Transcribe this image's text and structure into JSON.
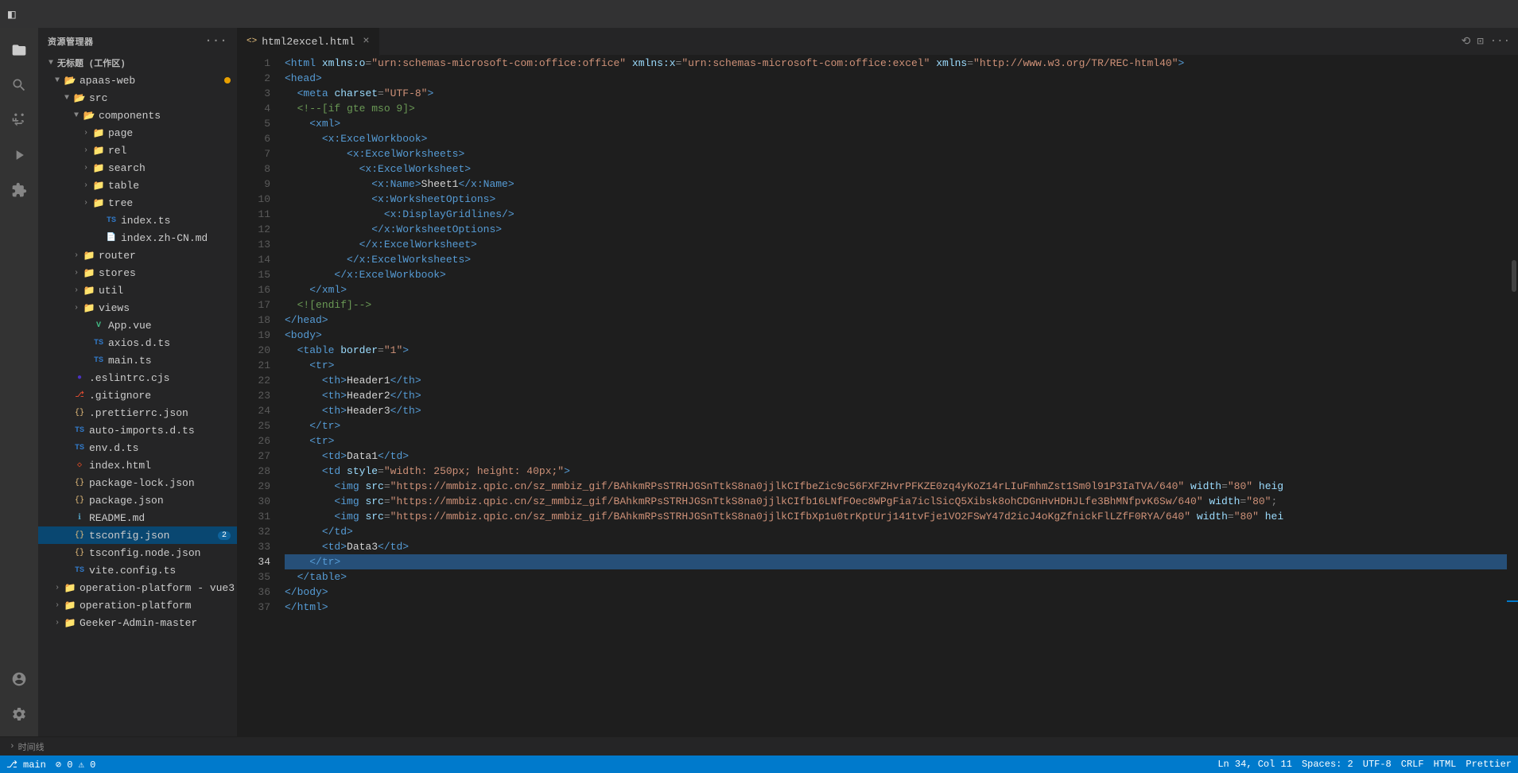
{
  "titleBar": {
    "icon": "◧",
    "title": "资源管理器",
    "dotsLabel": "···"
  },
  "tabs": [
    {
      "id": "tab-html2excel",
      "icon": "<>",
      "label": "html2excel.html",
      "active": true,
      "closable": true
    }
  ],
  "tabBarActions": [
    "⟲",
    "⊡",
    "···"
  ],
  "activityBar": {
    "icons": [
      {
        "id": "files-icon",
        "symbol": "⊞",
        "active": true
      },
      {
        "id": "search-icon",
        "symbol": "🔍",
        "active": false
      },
      {
        "id": "source-control-icon",
        "symbol": "⎇",
        "active": false
      },
      {
        "id": "run-icon",
        "symbol": "▶",
        "active": false
      },
      {
        "id": "extensions-icon",
        "symbol": "⊟",
        "active": false
      }
    ],
    "bottomIcons": [
      {
        "id": "account-icon",
        "symbol": "👤"
      },
      {
        "id": "settings-icon",
        "symbol": "⚙"
      }
    ]
  },
  "sidebar": {
    "title": "资源管理器",
    "workspace": "无标题 (工作区)",
    "tree": [
      {
        "id": "apaas-web",
        "label": "apaas-web",
        "type": "folder-open",
        "indent": 1,
        "expanded": true,
        "dot": true
      },
      {
        "id": "src",
        "label": "src",
        "type": "folder-open",
        "indent": 2,
        "expanded": true
      },
      {
        "id": "components",
        "label": "components",
        "type": "folder-open",
        "indent": 3,
        "expanded": true
      },
      {
        "id": "page",
        "label": "page",
        "type": "folder",
        "indent": 4,
        "expanded": false
      },
      {
        "id": "rel",
        "label": "rel",
        "type": "folder",
        "indent": 4,
        "expanded": false
      },
      {
        "id": "search",
        "label": "search",
        "type": "folder",
        "indent": 4,
        "expanded": false
      },
      {
        "id": "table",
        "label": "table",
        "type": "folder",
        "indent": 4,
        "expanded": false
      },
      {
        "id": "tree",
        "label": "tree",
        "type": "folder",
        "indent": 4,
        "expanded": false
      },
      {
        "id": "index-ts",
        "label": "index.ts",
        "type": "ts",
        "indent": 4
      },
      {
        "id": "index-zh-cn-md",
        "label": "index.zh-CN.md",
        "type": "md",
        "indent": 4
      },
      {
        "id": "router",
        "label": "router",
        "type": "folder",
        "indent": 3,
        "expanded": false
      },
      {
        "id": "stores",
        "label": "stores",
        "type": "folder",
        "indent": 3,
        "expanded": false
      },
      {
        "id": "util",
        "label": "util",
        "type": "folder",
        "indent": 3,
        "expanded": false
      },
      {
        "id": "views",
        "label": "views",
        "type": "folder",
        "indent": 3,
        "expanded": false
      },
      {
        "id": "app-vue",
        "label": "App.vue",
        "type": "vue",
        "indent": 3
      },
      {
        "id": "axios-d-ts",
        "label": "axios.d.ts",
        "type": "ts",
        "indent": 3
      },
      {
        "id": "main-ts",
        "label": "main.ts",
        "type": "ts",
        "indent": 3
      },
      {
        "id": "eslintrc-cjs",
        "label": ".eslintrc.cjs",
        "type": "eslint",
        "indent": 2
      },
      {
        "id": "gitignore",
        "label": ".gitignore",
        "type": "git",
        "indent": 2
      },
      {
        "id": "prettierrc-json",
        "label": ".prettierrc.json",
        "type": "json",
        "indent": 2
      },
      {
        "id": "auto-imports-d-ts",
        "label": "auto-imports.d.ts",
        "type": "ts",
        "indent": 2
      },
      {
        "id": "env-d-ts",
        "label": "env.d.ts",
        "type": "ts",
        "indent": 2
      },
      {
        "id": "index-html",
        "label": "index.html",
        "type": "html",
        "indent": 2
      },
      {
        "id": "package-lock-json",
        "label": "package-lock.json",
        "type": "json",
        "indent": 2
      },
      {
        "id": "package-json",
        "label": "package.json",
        "type": "json",
        "indent": 2
      },
      {
        "id": "readme-md",
        "label": "README.md",
        "type": "md",
        "indent": 2
      },
      {
        "id": "tsconfig-json",
        "label": "tsconfig.json",
        "type": "json",
        "indent": 2,
        "badge": "2",
        "selected": true
      },
      {
        "id": "tsconfig-node-json",
        "label": "tsconfig.node.json",
        "type": "json",
        "indent": 2
      },
      {
        "id": "vite-config-ts",
        "label": "vite.config.ts",
        "type": "ts",
        "indent": 2
      },
      {
        "id": "operation-platform-vue3",
        "label": "operation-platform - vue3",
        "type": "folder",
        "indent": 1,
        "expanded": false
      },
      {
        "id": "operation-platform",
        "label": "operation-platform",
        "type": "folder",
        "indent": 1,
        "expanded": false
      },
      {
        "id": "geeker-admin-master",
        "label": "Geeker-Admin-master",
        "type": "folder",
        "indent": 1,
        "expanded": false
      }
    ]
  },
  "editor": {
    "filename": "html2excel.html",
    "lines": [
      {
        "num": 1,
        "content": "<span class='tag'>&lt;html</span> <span class='attr-name'>xmlns:o</span><span class='punctuation'>=</span><span class='attr-val'>\"urn:schemas-microsoft-com:office:office\"</span> <span class='attr-name'>xmlns:x</span><span class='punctuation'>=</span><span class='attr-val'>\"urn:schemas-microsoft-com:office:excel\"</span> <span class='attr-name'>xmlns</span><span class='punctuation'>=</span><span class='string'>\"http://www.w3.org/TR/REC-html40\"</span><span class='tag'>&gt;</span>"
      },
      {
        "num": 2,
        "content": "<span class='tag'>&lt;head&gt;</span>"
      },
      {
        "num": 3,
        "content": "  <span class='tag'>&lt;meta</span> <span class='attr-name'>charset</span><span class='punctuation'>=</span><span class='attr-val'>\"UTF-8\"</span><span class='tag'>&gt;</span>"
      },
      {
        "num": 4,
        "content": "  <span class='comment'>&lt;!--[if gte mso 9]&gt;</span>"
      },
      {
        "num": 5,
        "content": "    <span class='tag'>&lt;xml&gt;</span>"
      },
      {
        "num": 6,
        "content": "      <span class='tag'>&lt;x:ExcelWorkbook&gt;</span>"
      },
      {
        "num": 7,
        "content": "        <span class='tag'>&lt;x:ExcelWorksheets&gt;</span>"
      },
      {
        "num": 8,
        "content": "          <span class='tag'>&lt;x:ExcelWorksheet&gt;</span>"
      },
      {
        "num": 9,
        "content": "            <span class='tag'>&lt;x:Name&gt;</span><span class='text-content'>Sheet1</span><span class='tag'>&lt;/x:Name&gt;</span>"
      },
      {
        "num": 10,
        "content": "            <span class='tag'>&lt;x:WorksheetOptions&gt;</span>"
      },
      {
        "num": 11,
        "content": "              <span class='tag'>&lt;x:DisplayGridlines/&gt;</span>"
      },
      {
        "num": 12,
        "content": "            <span class='tag'>&lt;/x:WorksheetOptions&gt;</span>"
      },
      {
        "num": 13,
        "content": "          <span class='tag'>&lt;/x:ExcelWorksheet&gt;</span>"
      },
      {
        "num": 14,
        "content": "        <span class='tag'>&lt;/x:ExcelWorksheets&gt;</span>"
      },
      {
        "num": 15,
        "content": "      <span class='tag'>&lt;/x:ExcelWorkbook&gt;</span>"
      },
      {
        "num": 16,
        "content": "    <span class='tag'>&lt;/xml&gt;</span>"
      },
      {
        "num": 17,
        "content": "  <span class='comment'>&lt;![endif]--&gt;</span>"
      },
      {
        "num": 18,
        "content": "<span class='tag'>&lt;/head&gt;</span>"
      },
      {
        "num": 19,
        "content": "<span class='tag'>&lt;body&gt;</span>"
      },
      {
        "num": 20,
        "content": "  <span class='tag'>&lt;table</span> <span class='attr-name'>border</span><span class='punctuation'>=</span><span class='attr-val'>\"1\"</span><span class='tag'>&gt;</span>"
      },
      {
        "num": 21,
        "content": "    <span class='tag'>&lt;tr&gt;</span>"
      },
      {
        "num": 22,
        "content": "      <span class='tag'>&lt;th&gt;</span><span class='text-content'>Header1</span><span class='tag'>&lt;/th&gt;</span>"
      },
      {
        "num": 23,
        "content": "      <span class='tag'>&lt;th&gt;</span><span class='text-content'>Header2</span><span class='tag'>&lt;/th&gt;</span>"
      },
      {
        "num": 24,
        "content": "      <span class='tag'>&lt;th&gt;</span><span class='text-content'>Header3</span><span class='tag'>&lt;/th&gt;</span>"
      },
      {
        "num": 25,
        "content": "    <span class='tag'>&lt;/tr&gt;</span>"
      },
      {
        "num": 26,
        "content": "    <span class='tag'>&lt;tr&gt;</span>"
      },
      {
        "num": 27,
        "content": "      <span class='tag'>&lt;td&gt;</span><span class='text-content'>Data1</span><span class='tag'>&lt;/td&gt;</span>"
      },
      {
        "num": 28,
        "content": "      <span class='tag'>&lt;td</span> <span class='attr-name'>style</span><span class='punctuation'>=</span><span class='attr-val'>\"width: 250px; height: 40px;\"</span><span class='tag'>&gt;</span>"
      },
      {
        "num": 29,
        "content": "        <span class='tag'>&lt;img</span> <span class='attr-name'>src</span><span class='punctuation'>=</span><span class='string'>\"https://mmbiz.qpic.cn/sz_mmbiz_gif/BAhkmRPsSTRHJGSnTtkS8na0jjlkCIfbeZic9c56FXFZHvrPFKZE0zq4yKoZ14rLIuFmhmZst1Sm0l91P3IaTVA/640\"</span> <span class='attr-name'>width</span><span class='punctuation'>=</span><span class='attr-val'>\"80\"</span> <span class='attr-name'>heig</span>"
      },
      {
        "num": 30,
        "content": "        <span class='tag'>&lt;img</span> <span class='attr-name'>src</span><span class='punctuation'>=</span><span class='string'>\"https://mmbiz.qpic.cn/sz_mmbiz_gif/BAhkmRPsSTRHJGSnTtkS8na0jjlkCIfb16LNfFOec8WPgFia7iclSicQ5Xibsk8ohCDGnHvHDHJLfe3BhMNfpvK6Sw/640\"</span> <span class='attr-name'>width</span><span class='punctuation'>=</span><span class='attr-val'>\"80\"</span><span class='punctuation'>;</span>"
      },
      {
        "num": 31,
        "content": "        <span class='tag'>&lt;img</span> <span class='attr-name'>src</span><span class='punctuation'>=</span><span class='string'>\"https://mmbiz.qpic.cn/sz_mmbiz_gif/BAhkmRPsSTRHJGSnTtkS8na0jjlkCIfbXp1u0trKptUrj141tvFje1VO2FSwY47d2icJ4oKgZfnickFlLZfF0RYA/640\"</span> <span class='attr-name'>width</span><span class='punctuation'>=</span><span class='attr-val'>\"80\"</span> <span class='attr-name'>hei</span>"
      },
      {
        "num": 32,
        "content": "      <span class='tag'>&lt;/td&gt;</span>"
      },
      {
        "num": 33,
        "content": "      <span class='tag'>&lt;td&gt;</span><span class='text-content'>Data3</span><span class='tag'>&lt;/td&gt;</span>"
      },
      {
        "num": 34,
        "content": "    <span class='tag'>&lt;/tr&gt;</span>",
        "highlighted": true
      },
      {
        "num": 35,
        "content": "  <span class='tag'>&lt;/table&gt;</span>"
      },
      {
        "num": 36,
        "content": "<span class='tag'>&lt;/body&gt;</span>"
      },
      {
        "num": 37,
        "content": "<span class='tag'>&lt;/html&gt;</span>"
      }
    ]
  },
  "statusBar": {
    "branch": "⎇  main",
    "errors": "⊘ 0  ⚠ 0",
    "rightItems": [
      "Ln 34, Col 11",
      "Spaces: 2",
      "UTF-8",
      "CRLF",
      "HTML",
      "Prettier"
    ]
  },
  "bottomPanel": {
    "label": "时间线"
  }
}
